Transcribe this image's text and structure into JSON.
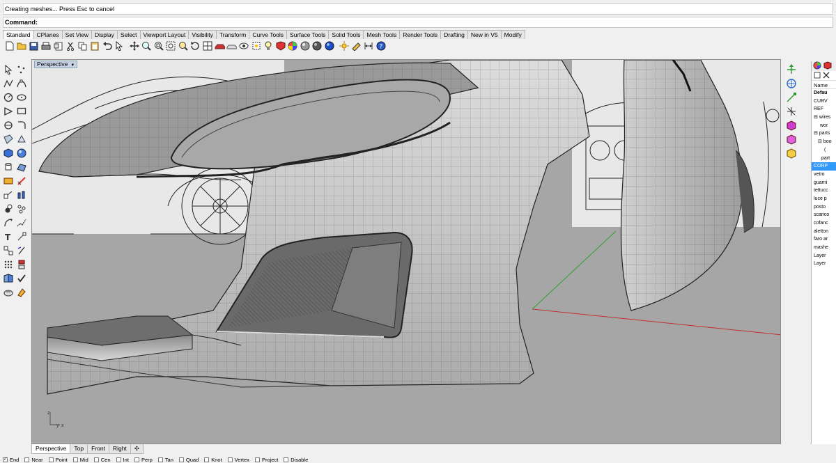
{
  "command_history": "Creating meshes... Press Esc to cancel",
  "command_prompt": "Command:",
  "toolbar_tabs": [
    "Standard",
    "CPlanes",
    "Set View",
    "Display",
    "Select",
    "Viewport Layout",
    "Visibility",
    "Transform",
    "Curve Tools",
    "Surface Tools",
    "Solid Tools",
    "Mesh Tools",
    "Render Tools",
    "Drafting",
    "New in V5",
    "Modify"
  ],
  "viewport": {
    "title": "Perspective"
  },
  "viewport_tabs": [
    "Perspective",
    "Top",
    "Front",
    "Right"
  ],
  "axis_labels": {
    "z": "z",
    "y": "y",
    "x": "x"
  },
  "layers": {
    "header": "Name",
    "rows": [
      {
        "label": "Defau",
        "bold": true
      },
      {
        "label": "CURV"
      },
      {
        "label": "REF"
      },
      {
        "label": "wires",
        "expander": "⊟"
      },
      {
        "label": "wor"
      },
      {
        "label": "parts",
        "expander": "⊟"
      },
      {
        "label": "boo",
        "expander": "⊟"
      },
      {
        "label": "("
      },
      {
        "label": "part"
      },
      {
        "label": "CORP",
        "selected": true
      },
      {
        "label": "vetro"
      },
      {
        "label": "guarni"
      },
      {
        "label": "tettucc"
      },
      {
        "label": "luce p"
      },
      {
        "label": "posto"
      },
      {
        "label": "scarico"
      },
      {
        "label": "cofanc"
      },
      {
        "label": "aletton"
      },
      {
        "label": "faro ar"
      },
      {
        "label": "mashe"
      },
      {
        "label": "Layer"
      },
      {
        "label": "Layer"
      }
    ]
  },
  "osnap": [
    {
      "label": "End",
      "checked": true
    },
    {
      "label": "Near",
      "checked": false
    },
    {
      "label": "Point",
      "checked": false
    },
    {
      "label": "Mid",
      "checked": false
    },
    {
      "label": "Cen",
      "checked": false
    },
    {
      "label": "Int",
      "checked": false
    },
    {
      "label": "Perp",
      "checked": false
    },
    {
      "label": "Tan",
      "checked": false
    },
    {
      "label": "Quad",
      "checked": false
    },
    {
      "label": "Knot",
      "checked": false
    },
    {
      "label": "Vertex",
      "checked": false
    },
    {
      "label": "Project",
      "checked": false
    },
    {
      "label": "Disable",
      "checked": false
    }
  ],
  "colors": {
    "viewport_bg": "#a6a6a6",
    "selected_layer": "#3399ff",
    "x_axis": "#c03030",
    "y_axis": "#30a030"
  }
}
